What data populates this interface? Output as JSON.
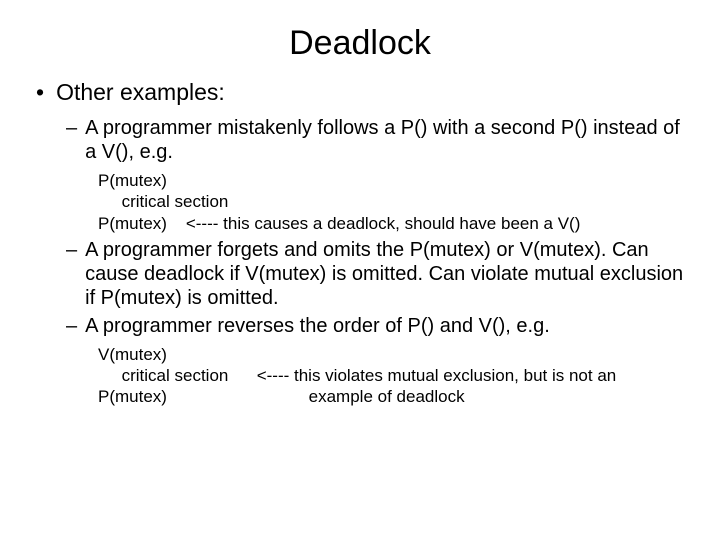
{
  "title": "Deadlock",
  "bullet1": "Other examples:",
  "sub1": "A programmer mistakenly follows a P() with a second P() instead of a V(), e.g.",
  "code1": [
    "P(mutex)",
    "     critical section",
    "P(mutex)    <---- this causes a deadlock, should have been a V()"
  ],
  "sub2": "A programmer forgets and omits the P(mutex) or V(mutex).  Can cause deadlock if V(mutex) is omitted. Can violate mutual exclusion if P(mutex) is omitted.",
  "sub3": "A programmer reverses the order of P() and V(), e.g.",
  "code2": [
    "V(mutex)",
    "     critical section      <---- this violates mutual exclusion, but is not an",
    "P(mutex)                              example of deadlock"
  ]
}
